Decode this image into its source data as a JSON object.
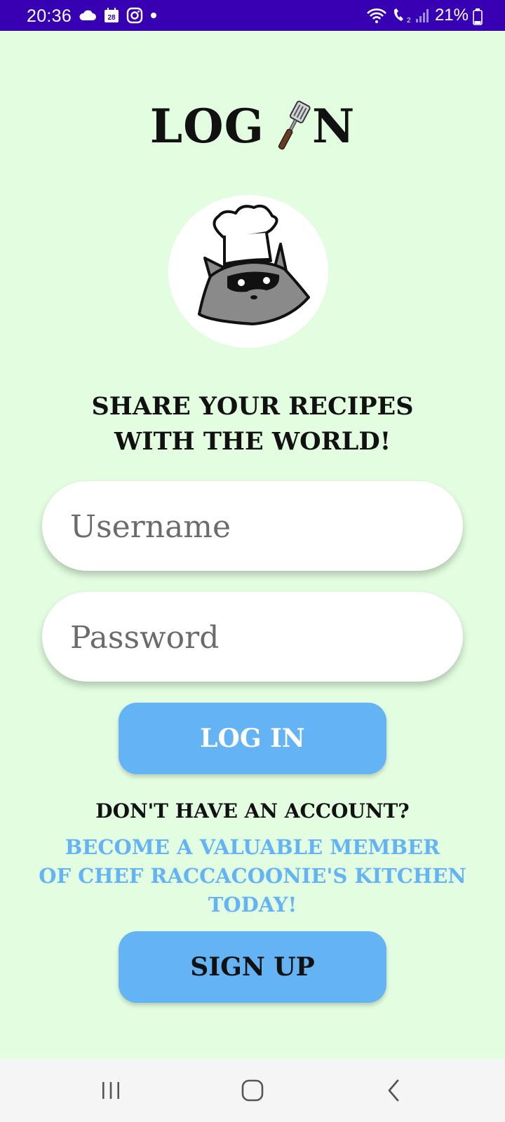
{
  "status_bar": {
    "time": "20:36",
    "calendar_day": "28",
    "battery": "21%",
    "background_color": "#3700b3"
  },
  "header": {
    "title_left": "LOG",
    "title_right": "N",
    "title_icon": "spatula-icon"
  },
  "tagline": {
    "line1": "SHARE YOUR RECIPES",
    "line2": "WITH THE WORLD!"
  },
  "form": {
    "username_placeholder": "Username",
    "username_value": "",
    "password_placeholder": "Password",
    "password_value": "",
    "login_label": "LOG IN"
  },
  "signup": {
    "question": "DON'T HAVE AN ACCOUNT?",
    "promo_line1": "BECOME A VALUABLE MEMBER",
    "promo_line2": "OF CHEF RACCACOONIE'S KITCHEN",
    "promo_line3": "TODAY!",
    "signup_label": "SIGN UP"
  },
  "colors": {
    "background": "#e2fde0",
    "button": "#64b3f4",
    "promo_text": "#64b3f4",
    "status_bar": "#3700b3"
  },
  "nav_bar": {
    "icons": [
      "recent-apps-icon",
      "home-icon",
      "back-icon"
    ]
  }
}
